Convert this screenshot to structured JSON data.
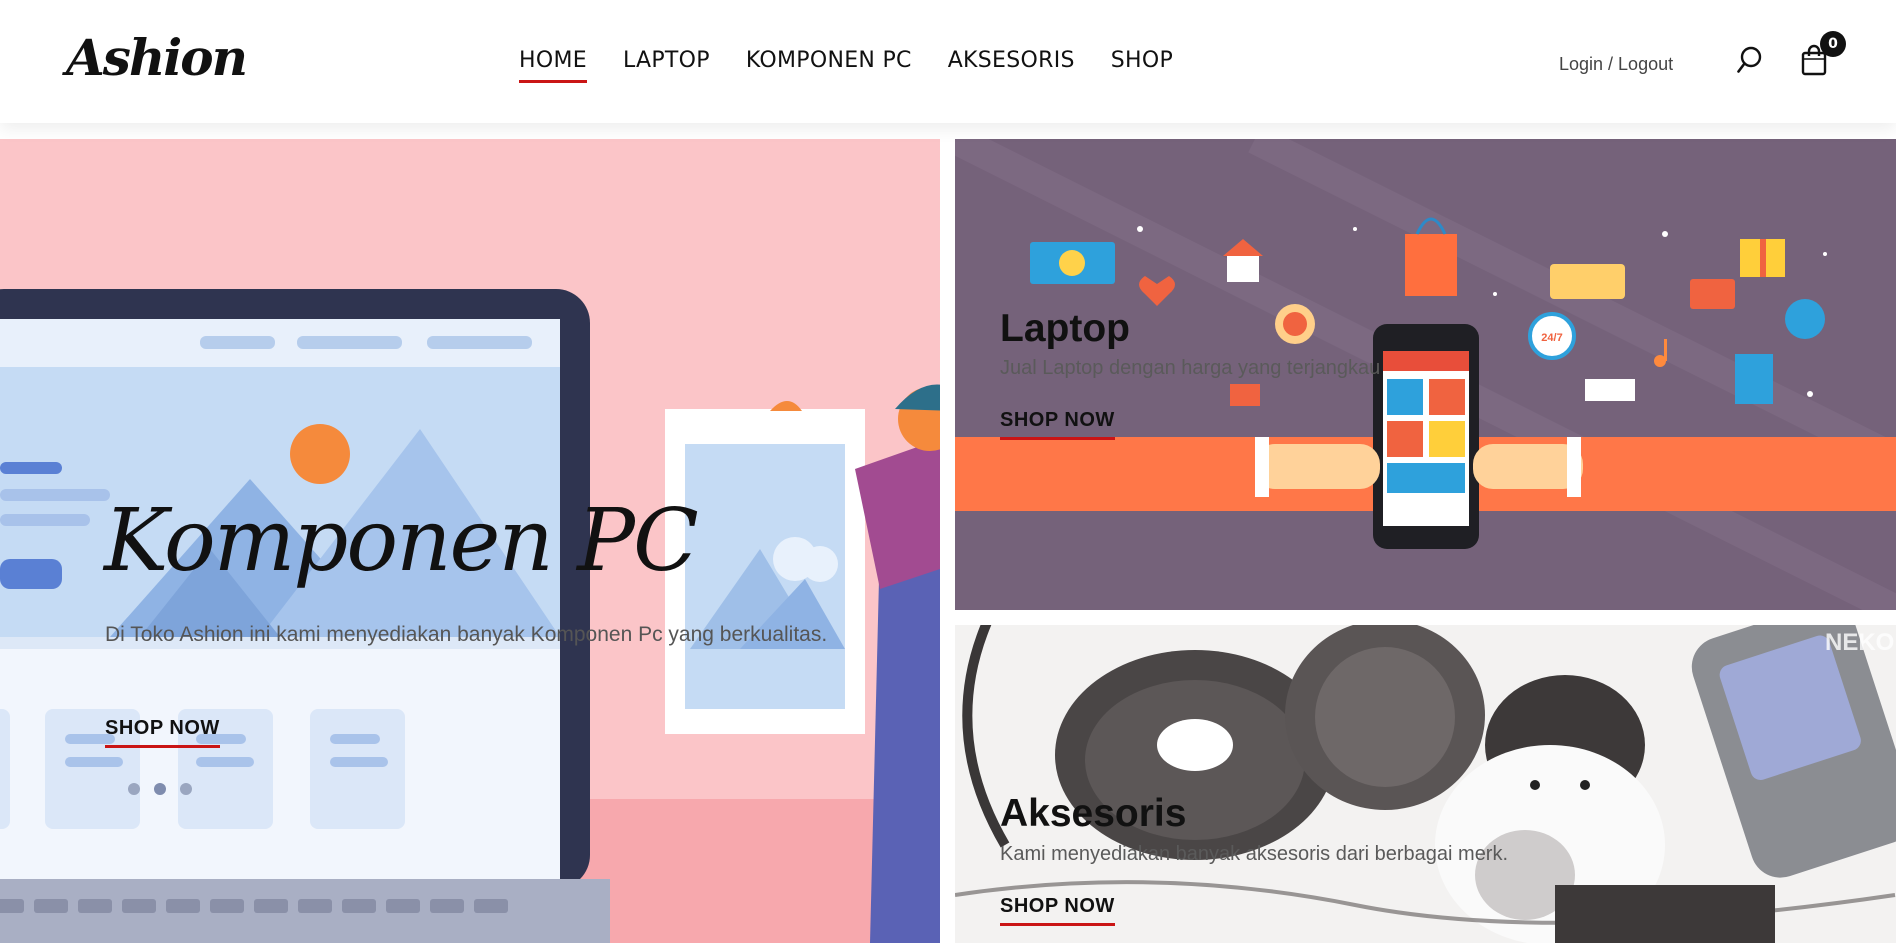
{
  "header": {
    "logo": "Ashion",
    "nav": [
      {
        "label": "HOME",
        "active": true
      },
      {
        "label": "LAPTOP",
        "active": false
      },
      {
        "label": "KOMPONEN PC",
        "active": false
      },
      {
        "label": "AKSESORIS",
        "active": false
      },
      {
        "label": "SHOP",
        "active": false
      }
    ],
    "login_label": "Login / Logout",
    "cart_count": "0",
    "icons": [
      "search-icon",
      "shopping-bag-icon"
    ]
  },
  "hero": {
    "main": {
      "title": "Komponen PC",
      "description": "Di Toko Ashion ini kami menyediakan banyak Komponen Pc yang berkualitas.",
      "cta": "SHOP NOW"
    },
    "laptop": {
      "title": "Laptop",
      "description": "Jual Laptop dengan harga yang terjangkau",
      "cta": "SHOP NOW"
    },
    "accessories": {
      "title": "Aksesoris",
      "description": "Kami menyediakan banyak aksesoris dari berbagai merk.",
      "cta": "SHOP NOW"
    },
    "slider_dot_count": 3,
    "illustration_text": {
      "phone_badge": "24/7",
      "watermark": "NEKO"
    }
  },
  "colors": {
    "accent": "#ca1515",
    "main_banner_bg": "#fbc5c8",
    "laptop_banner_bg": "#75627a",
    "text": "#111111"
  }
}
